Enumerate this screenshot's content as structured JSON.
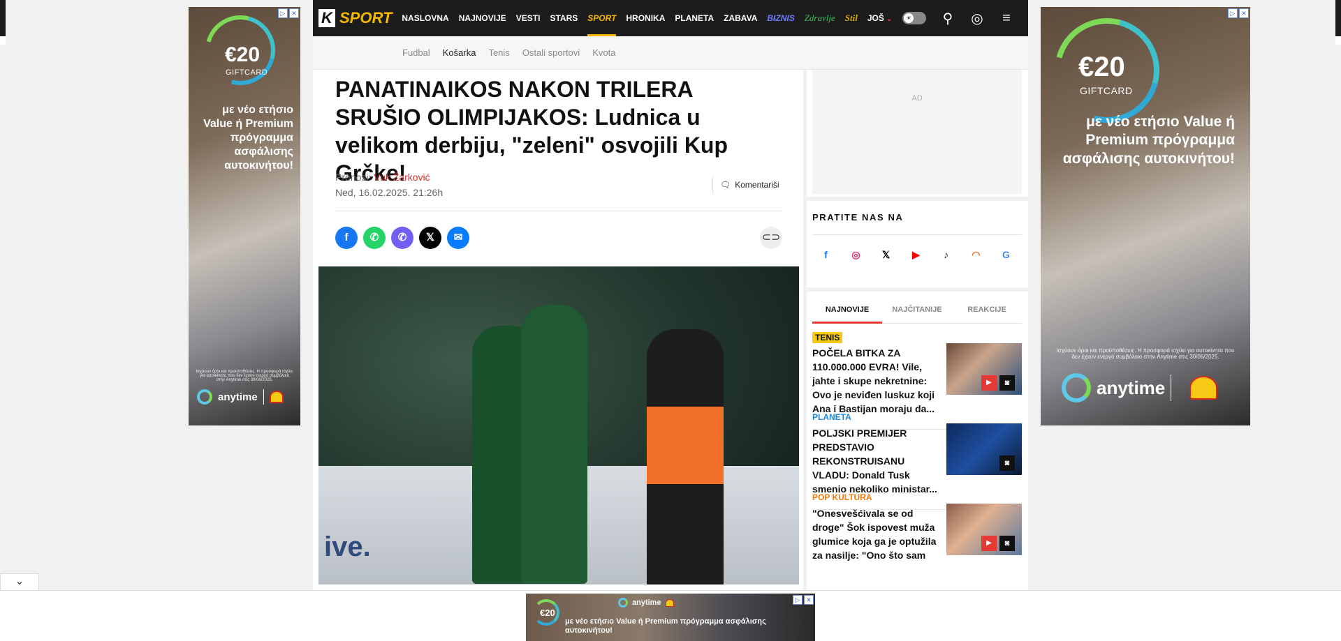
{
  "header": {
    "logo_k": "K",
    "logo_sport": "SPORT",
    "nav": [
      "NASLOVNA",
      "NAJNOVIJE",
      "VESTI",
      "STARS",
      "SPORT",
      "HRONIKA",
      "PLANETA",
      "ZABAVA",
      "BIZNIS",
      "Zdravlje",
      "Stil",
      "JOŠ"
    ],
    "active": "SPORT",
    "more_chevron": "⌄",
    "theme_toggle_icon": "☀",
    "search_icon": "⚲",
    "account_icon": "◎",
    "menu_icon": "≡"
  },
  "subnav": {
    "items": [
      "Fudbal",
      "Košarka",
      "Tenis",
      "Ostali sportovi",
      "Kvota"
    ],
    "active": "Košarka"
  },
  "article": {
    "title": "PANATINAIKOS NAKON TRILERA SRUŠIO OLIMPIJAKOS: Ludnica u velikom derbiju, \"zeleni\" osvojili Kup Grčke!",
    "byline_label": "Prenosi: ",
    "author": "Vuk Žarković",
    "date": "Ned, 16.02.2025. 21:26h",
    "comment_label": "Komentariši",
    "comment_icon": "🗨",
    "share_icons": [
      "f",
      "✆",
      "✆",
      "𝕏",
      "✉"
    ],
    "share_names": [
      "facebook-icon",
      "whatsapp-icon",
      "viber-icon",
      "x-icon",
      "messenger-icon"
    ],
    "share_colors": [
      "#1877f2",
      "#25d366",
      "#7360f2",
      "#000000",
      "#0a7cff"
    ],
    "copy_link_icon": "⊂⊃",
    "photo_watermark": "ive."
  },
  "sidebar": {
    "ad_label": "AD",
    "follow_heading": "PRATITE NAS NA",
    "follow_icons": [
      {
        "name": "facebook-icon",
        "glyph": "f",
        "color": "#1877f2"
      },
      {
        "name": "instagram-icon",
        "glyph": "◎",
        "color": "#e1306c"
      },
      {
        "name": "x-icon",
        "glyph": "𝕏",
        "color": "#000000"
      },
      {
        "name": "youtube-icon",
        "glyph": "▶",
        "color": "#ff0000"
      },
      {
        "name": "tiktok-icon",
        "glyph": "♪",
        "color": "#111111"
      },
      {
        "name": "rss-icon",
        "glyph": "◠",
        "color": "#f26522"
      },
      {
        "name": "google-news-icon",
        "glyph": "G",
        "color": "#4285f4"
      }
    ],
    "tabs": [
      "NAJNOVIJE",
      "NAJČITANIJE",
      "REAKCIJE"
    ],
    "active_tab": "NAJNOVIJE",
    "news": [
      {
        "category": "TENIS",
        "cat_class": "tenis",
        "text": "POČELA BITKA ZA 110.000.000 EVRA! Vile, jahte i skupe nekretnine: Ovo je neviđen luskuz koji Ana i Bastijan moraju da...",
        "video": true
      },
      {
        "category": "PLANETA",
        "cat_class": "planeta",
        "text": "POLJSKI PREMIJER PREDSTAVIO REKONSTRUISANU VLADU: Donald Tusk smenio nekoliko ministar...",
        "video": false
      },
      {
        "category": "POP KULTURA",
        "cat_class": "pop",
        "text": "\"Onesvešćivala se od droge\" Šok ispovest muža glumice koja ga je optužila za nasilje: \"Ono što sam",
        "video": true
      }
    ],
    "play_icon": "▶",
    "camera_icon": "◙"
  },
  "ads": {
    "badge_info": "▷",
    "badge_close": "✕",
    "gift_amount": "€20",
    "gift_label": "GIFTCARD",
    "promo": "με νέο ετήσιο Value ή Premium πρόγραμμα ασφάλισης αυτοκινήτου!",
    "fine_print": "Ισχύουν όροι και προϋποθέσεις. Η προσφορά ισχύει για αυτοκίνητα που δεν έχουν ενεργό συμβόλαιο στην Anytime στις 30/06/2025.",
    "brand": "anytime",
    "collapse_icon": "⌄"
  }
}
